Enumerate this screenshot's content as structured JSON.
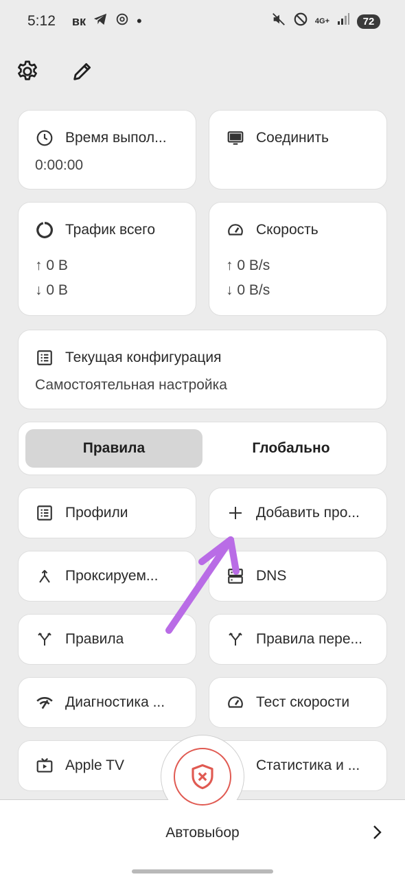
{
  "status": {
    "time": "5:12",
    "left_glyphs": [
      "вк"
    ],
    "network": "4G+",
    "battery": "72"
  },
  "cards": {
    "runtime": {
      "title": "Время выпол...",
      "value": "0:00:00"
    },
    "connect": {
      "title": "Соединить"
    },
    "traffic": {
      "title": "Трафик всего",
      "up": "↑ 0 B",
      "down": "↓ 0 B"
    },
    "speed": {
      "title": "Скорость",
      "up": "↑ 0 B/s",
      "down": "↓ 0 B/s"
    },
    "config": {
      "title": "Текущая конфигурация",
      "value": "Самостоятельная настройка"
    }
  },
  "mode_toggle": {
    "rules": "Правила",
    "global": "Глобально",
    "selected": "rules"
  },
  "tiles": {
    "profiles": "Профили",
    "add_profile": "Добавить про...",
    "proxies": "Проксируем...",
    "dns": "DNS",
    "rules": "Правила",
    "override_rules": "Правила пере...",
    "diagnostics": "Диагностика ...",
    "speedtest": "Тест скорости",
    "appletv": "Apple TV",
    "statistics": "Статистика и ..."
  },
  "bottom": {
    "mode_label": "Автовыбор"
  },
  "colors": {
    "accent_red": "#e05a52",
    "annotation_arrow": "#b96ce6",
    "background": "#ececec"
  }
}
